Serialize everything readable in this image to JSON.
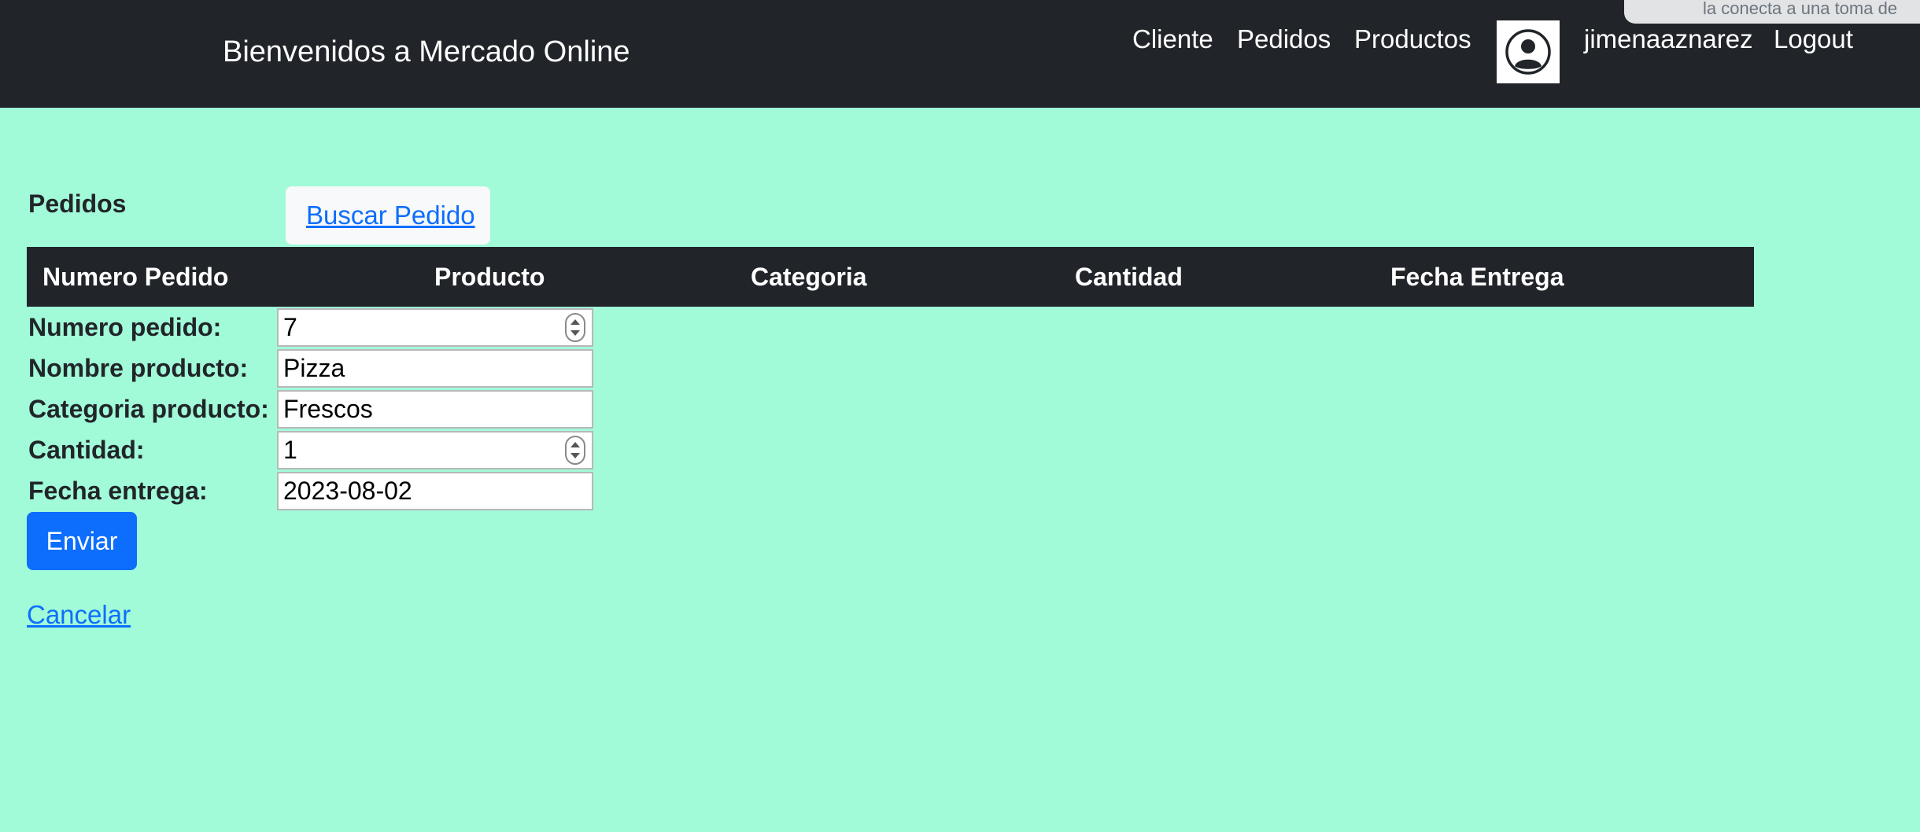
{
  "navbar": {
    "brand": "Bienvenidos a Mercado Online",
    "links": {
      "cliente": "Cliente",
      "pedidos": "Pedidos",
      "productos": "Productos",
      "username": "jimenaaznarez",
      "logout": "Logout"
    },
    "avatar_icon": "user-circle-icon",
    "notification_fragment": "la conecta a una toma de"
  },
  "main": {
    "section_title": "Pedidos",
    "search_link": "Buscar Pedido",
    "table": {
      "headers": [
        "Numero Pedido",
        "Producto",
        "Categoria",
        "Cantidad",
        "Fecha Entrega"
      ]
    },
    "form": {
      "fields": [
        {
          "label": "Numero pedido:",
          "value": "7",
          "type": "number"
        },
        {
          "label": "Nombre producto:",
          "value": "Pizza",
          "type": "text"
        },
        {
          "label": "Categoria producto:",
          "value": "Frescos",
          "type": "text"
        },
        {
          "label": "Cantidad:",
          "value": "1",
          "type": "number"
        },
        {
          "label": "Fecha entrega:",
          "value": "2023-08-02",
          "type": "text"
        }
      ],
      "submit_label": "Enviar",
      "cancel_label": "Cancelar"
    }
  },
  "colors": {
    "background": "#a1fad8",
    "navbar": "#212529",
    "primary": "#0d6efd"
  }
}
